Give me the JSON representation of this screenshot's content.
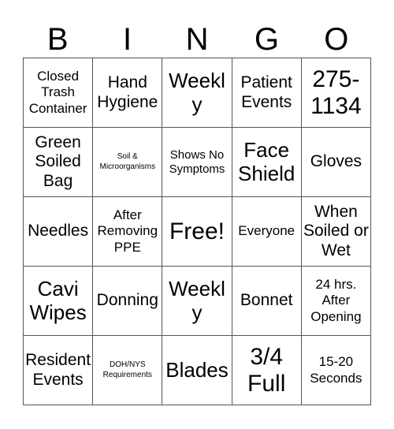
{
  "card": {
    "title": "BINGO",
    "columns": [
      "B",
      "I",
      "N",
      "G",
      "O"
    ],
    "colors": {
      "background": "#ffffff",
      "text": "#000000",
      "grid_line": "#555555"
    },
    "rows": [
      [
        {
          "text": "Closed Trash Container",
          "size": "sm"
        },
        {
          "text": "Hand Hygiene",
          "size": "md"
        },
        {
          "text": "Weekly",
          "size": "lg"
        },
        {
          "text": "Patient Events",
          "size": "md"
        },
        {
          "text": "275-1134",
          "size": "xl"
        }
      ],
      [
        {
          "text": "Green Soiled Bag",
          "size": "md"
        },
        {
          "text": "Soil & Microorganisms",
          "size": "tiny"
        },
        {
          "text": "Shows No Symptoms",
          "size": "xs"
        },
        {
          "text": "Face Shield",
          "size": "lg"
        },
        {
          "text": "Gloves",
          "size": "md"
        }
      ],
      [
        {
          "text": "Needles",
          "size": "md"
        },
        {
          "text": "After Removing PPE",
          "size": "sm"
        },
        {
          "text": "Free!",
          "size": "xl"
        },
        {
          "text": "Everyone",
          "size": "sm"
        },
        {
          "text": "When Soiled or Wet",
          "size": "md"
        }
      ],
      [
        {
          "text": "Cavi Wipes",
          "size": "lg"
        },
        {
          "text": "Donning",
          "size": "md"
        },
        {
          "text": "Weekly",
          "size": "lg"
        },
        {
          "text": "Bonnet",
          "size": "md"
        },
        {
          "text": "24 hrs. After Opening",
          "size": "sm"
        }
      ],
      [
        {
          "text": "Resident Events",
          "size": "md"
        },
        {
          "text": "DOH/NYS Requirements",
          "size": "tiny"
        },
        {
          "text": "Blades",
          "size": "lg"
        },
        {
          "text": "3/4 Full",
          "size": "xl"
        },
        {
          "text": "15-20 Seconds",
          "size": "sm"
        }
      ]
    ]
  }
}
